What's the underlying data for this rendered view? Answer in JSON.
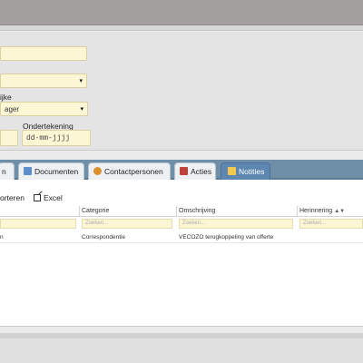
{
  "form": {
    "label_partial": "ijke",
    "select1_value": "",
    "select2_value": "ager",
    "ondertekening_label": "Ondertekening",
    "date_placeholder": "dd-mm-jjjj",
    "arrow": "▾"
  },
  "tabs": [
    {
      "label": "n",
      "icon": "tab-icon"
    },
    {
      "label": "Documenten",
      "icon": "documents-icon"
    },
    {
      "label": "Contactpersonen",
      "icon": "contacts-icon"
    },
    {
      "label": "Acties",
      "icon": "actions-icon"
    },
    {
      "label": "Notities",
      "icon": "notes-icon",
      "active": true
    }
  ],
  "toolbar": {
    "import_label": "orteren",
    "excel_label": "Excel"
  },
  "table": {
    "columns": [
      "Categorie",
      "Omschrijving",
      "Herinnering"
    ],
    "filter_placeholder": "Zoeken...",
    "rows": [
      {
        "first": "n",
        "categorie": "Correspondentie",
        "omschrijving": "VECOZO terugkoppeling van offerte",
        "herinnering": ""
      }
    ]
  },
  "colors": {
    "tabbar": "#6f8fa8",
    "active_tab": "#5d87b0",
    "field_bg": "#fdf6d5"
  }
}
